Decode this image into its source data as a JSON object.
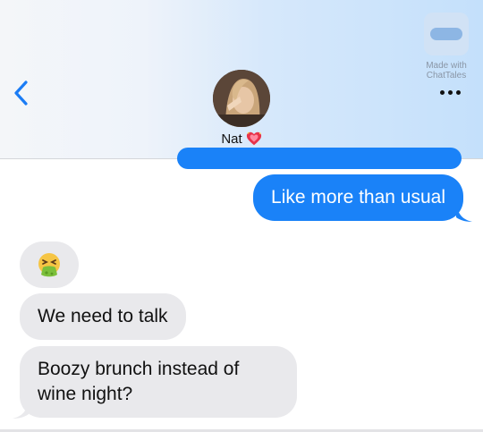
{
  "header": {
    "contact_name": "Nat",
    "watermark": "Made with\nChatTales"
  },
  "icons": {
    "back": "chevron-left-icon",
    "more": "more-dots-icon",
    "heart": "sparkling-heart-icon",
    "emoji": "nauseated-face-emoji"
  },
  "colors": {
    "outgoing": "#1a82f8",
    "incoming": "#e9e9ec",
    "accent": "#1a7cf5"
  },
  "messages": [
    {
      "from": "me",
      "text": "Like more than usual"
    },
    {
      "from": "them",
      "emoji": "🤮"
    },
    {
      "from": "them",
      "text": "We need to talk"
    },
    {
      "from": "them",
      "text": "Boozy brunch instead of wine night?"
    }
  ]
}
